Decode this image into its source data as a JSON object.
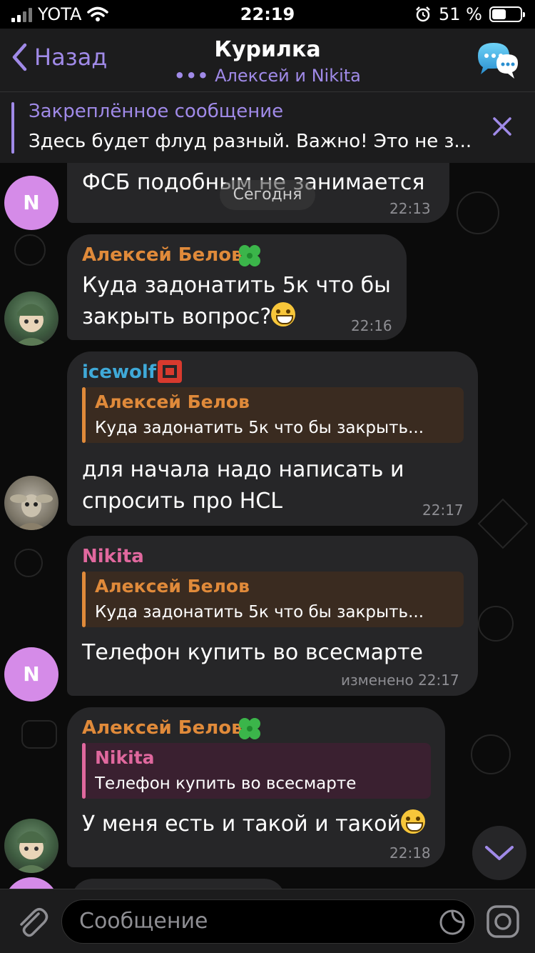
{
  "status_bar": {
    "carrier": "YOTA",
    "time": "22:19",
    "battery_percent": "51 %",
    "battery_level": 0.51
  },
  "header": {
    "back_label": "Назад",
    "title": "Курилка",
    "subtitle": "Алексей и Nikita",
    "chat_icon": "chat-bubbles-icon"
  },
  "pinned": {
    "title": "Закреплённое сообщение",
    "text": "Здесь будет флуд разный. Важно! Это не з..."
  },
  "chat": {
    "date_label": "Сегодня",
    "messages": [
      {
        "avatar_letter": "N",
        "text": "ФСБ подобным не занимается",
        "time": "22:13"
      },
      {
        "sender": "Алексей Белов",
        "sender_color": "#e08a3a",
        "badge": "clover-icon",
        "text_line1": "Куда задонатить 5к что бы",
        "text_line2": "закрыть вопрос?",
        "time": "22:16"
      },
      {
        "sender": "icewolf",
        "sender_color": "#3fa9d8",
        "badge": "redis-logo-icon",
        "reply_name": "Алексей Белов",
        "reply_text": "Куда задонатить 5к что бы закрыть...",
        "text_line1": "для начала надо написать и",
        "text_line2": "спросить про HCL",
        "time": "22:17"
      },
      {
        "sender": "Nikita",
        "sender_color": "#e0689e",
        "reply_name": "Алексей Белов",
        "reply_text": "Куда задонатить 5к что бы закрыть...",
        "text": "Телефон купить во всесмарте",
        "time": "изменено 22:17",
        "avatar_letter": "N"
      },
      {
        "sender": "Алексей Белов",
        "sender_color": "#e08a3a",
        "badge": "clover-icon",
        "reply_name": "Nikita",
        "reply_color": "#e0689e",
        "reply_text": "Телефон купить во всесмарте",
        "text": "У меня есть и такой и такой",
        "time": "22:18"
      }
    ]
  },
  "input": {
    "placeholder": "Сообщение"
  },
  "colors": {
    "accent": "#a08ae8",
    "bubble": "#262628",
    "bar": "#1c1c1d"
  }
}
